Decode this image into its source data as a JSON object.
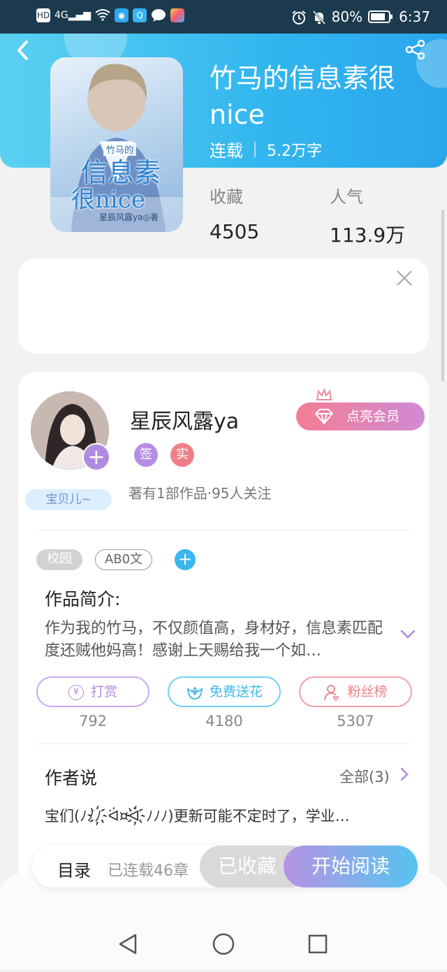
{
  "status_bar": {
    "left_icons": [
      "hd-icon",
      "signal-icon",
      "wifi-icon",
      "app-icon-1",
      "app-icon-2",
      "message-icon",
      "app-icon-3"
    ],
    "signal_label": "4G",
    "battery": "80%",
    "time": "6:37"
  },
  "book": {
    "title_line1": "竹马的信息素很",
    "title_line2": "nice",
    "status": "连载",
    "word_count": "5.2万字",
    "cover": {
      "small_label": "竹马的",
      "big_title_1": "信息素",
      "big_title_2": "很nice",
      "author_line": "星辰风露ya◎著"
    }
  },
  "stats": {
    "favorites_label": "收藏",
    "favorites_value": "4505",
    "popularity_label": "人气",
    "popularity_value": "113.9万"
  },
  "author": {
    "name": "星辰风露ya",
    "badge_sign": "签",
    "badge_real": "实",
    "nickname_tag": "宝贝儿~",
    "works": "著有1部作品·95人关注",
    "vip_button": "点亮会员"
  },
  "tags": [
    "校园",
    "AB0文"
  ],
  "intro": {
    "heading": "作品简介:",
    "text": "作为我的竹马，不仅颜值高，身材好，信息素匹配度还贼他妈高！感谢上天赐给我一个如…"
  },
  "actions": [
    {
      "label": "打赏",
      "count": "792",
      "color": "#b08be0"
    },
    {
      "label": "免费送花",
      "count": "4180",
      "color": "#4cc2ef"
    },
    {
      "label": "粉丝榜",
      "count": "5307",
      "color": "#ef7f87"
    }
  ],
  "author_says": {
    "heading": "作者说",
    "all_label": "全部(3)",
    "text": "宝们(ﾉﾉﾉ҉ᐛ¤ᐛ҉ﾉﾉﾉ)更新可能不定时了，学业…"
  },
  "bottom_bar": {
    "catalog": "目录",
    "chapters": "已连载46章",
    "collected": "已收藏",
    "start_reading": "开始阅读"
  },
  "colors": {
    "header_start": "#5bd1f1",
    "header_end": "#2aa6ec",
    "accent_purple": "#b08be0",
    "accent_pink": "#ef7f87",
    "accent_blue": "#4cc2ef"
  }
}
